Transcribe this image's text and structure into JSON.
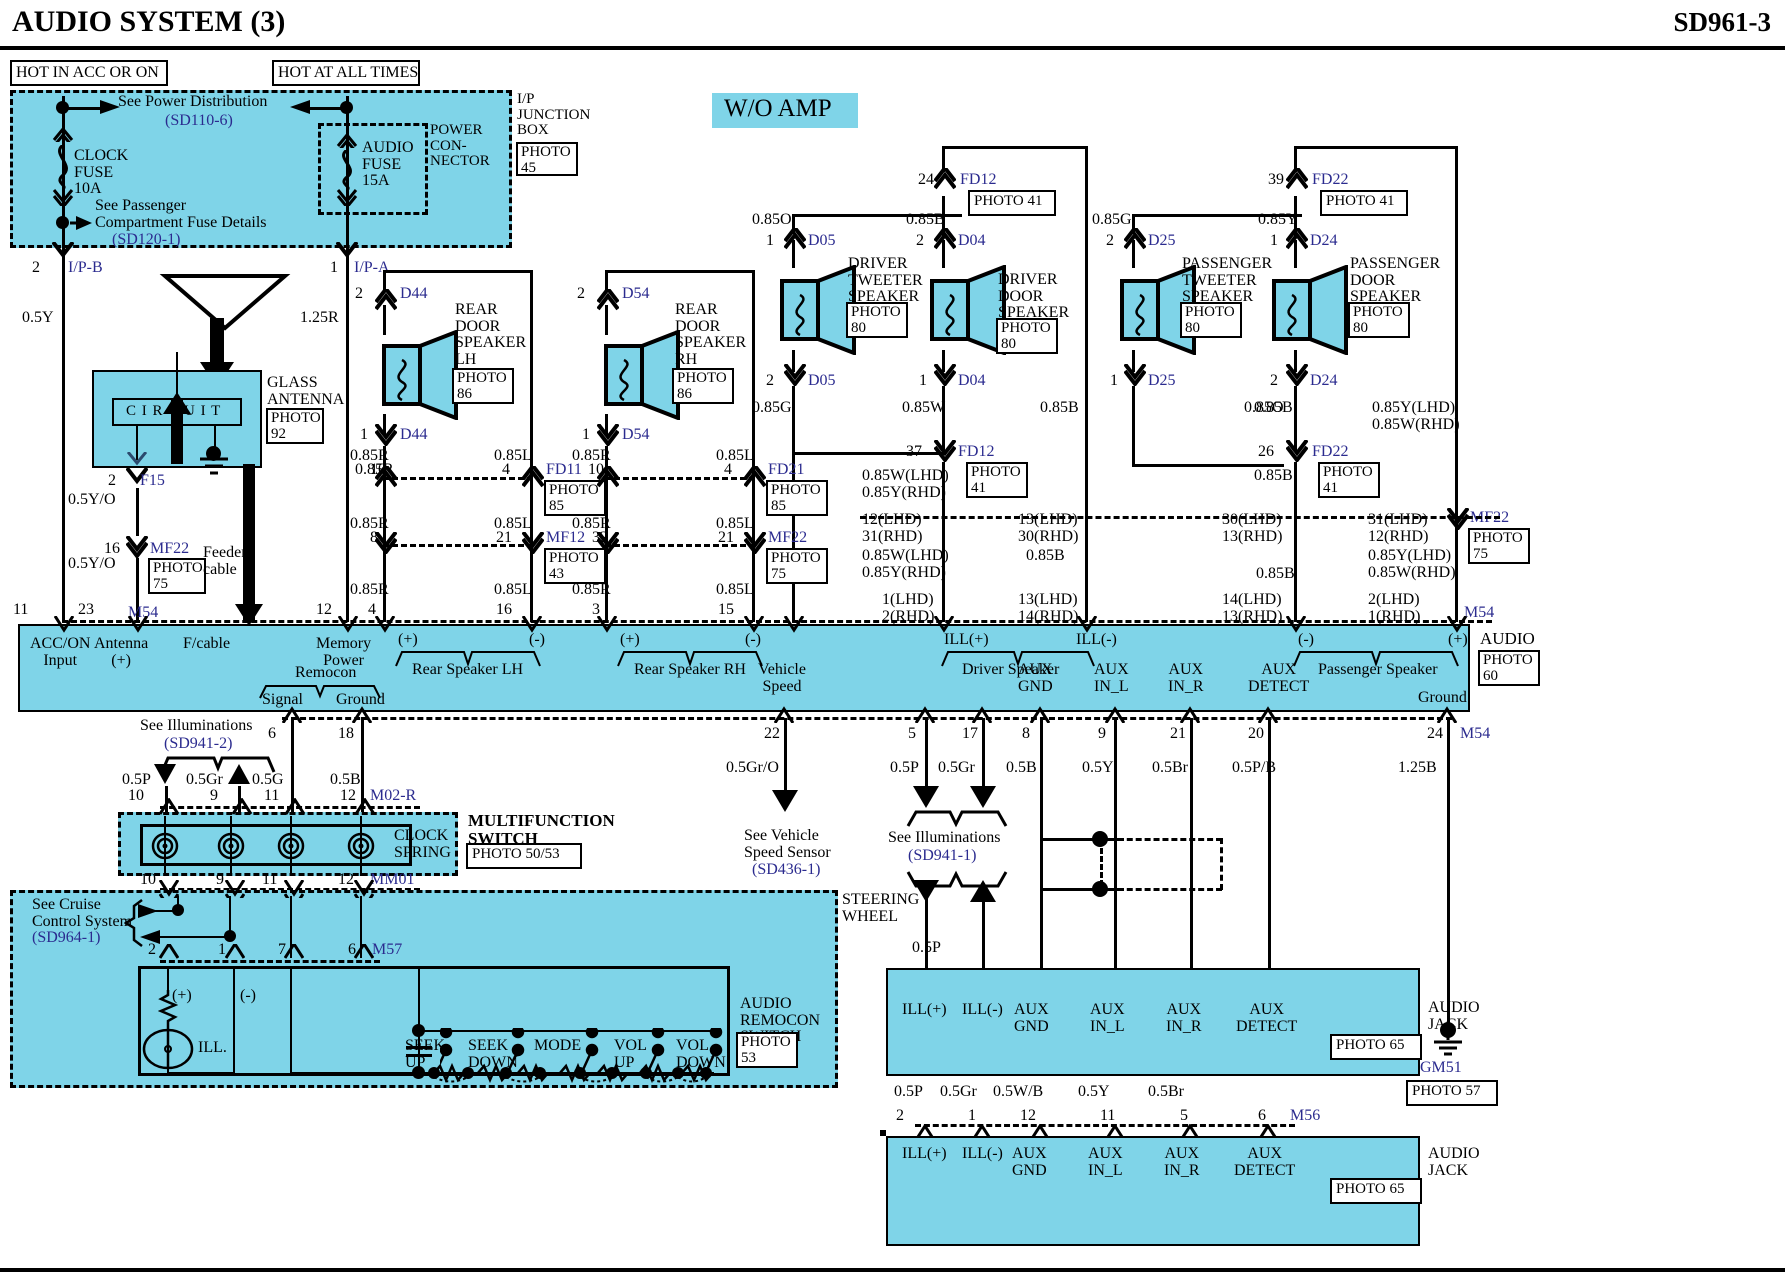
{
  "header": {
    "title": "AUDIO SYSTEM (3)",
    "code": "SD961-3"
  },
  "banner": {
    "wo_amp": "W/O AMP"
  },
  "power": {
    "hot_acc": "HOT IN ACC OR ON",
    "hot_all": "HOT AT ALL TIMES",
    "see_power_dist": "See Power Distribution",
    "see_power_dist_ref": "(SD110-6)",
    "see_passenger_1": "See Passenger",
    "see_passenger_2": "Compartment Fuse Details",
    "see_passenger_ref": "(SD120-1)",
    "clock_fuse": "CLOCK\nFUSE\n10A",
    "audio_fuse": "AUDIO\nFUSE\n15A",
    "power_connector": "POWER\nCON-\nNECTOR",
    "ip_junction_box": "I/P\nJUNCTION\nBOX",
    "photo45": "PHOTO\n45",
    "ipb_pin": "2",
    "ipb_name": "I/P-B",
    "ipa_pin": "1",
    "ipa_name": "I/P-A",
    "wire_05y": "0.5Y",
    "wire_125r": "1.25R"
  },
  "antenna": {
    "label": "GLASS\nANTENNA",
    "photo": "PHOTO\n92",
    "circuit": "C I R C U I T",
    "f15_pin": "2",
    "f15_name": "F15",
    "wire_05yo_top": "0.5Y/O",
    "mf22_pin": "16",
    "mf22_name": "MF22",
    "mf22_photo": "PHOTO\n75",
    "wire_05yo_bot": "0.5Y/O",
    "feeder": "Feeder\ncable"
  },
  "speakers": [
    {
      "name": "REAR\nDOOR\nSPEAKER\nLH",
      "photo": "PHOTO\n86",
      "top_pin": "2",
      "top_conn": "D44",
      "bot_pin": "1",
      "bot_conn": "D44"
    },
    {
      "name": "REAR\nDOOR\nSPEAKER\nRH",
      "photo": "PHOTO\n86",
      "top_pin": "2",
      "top_conn": "D54",
      "bot_pin": "1",
      "bot_conn": "D54"
    },
    {
      "name": "DRIVER\nTWEETER\nSPEAKER",
      "photo": "PHOTO\n80",
      "top_pin": "1",
      "top_conn": "D05",
      "bot_pin": "2",
      "bot_conn": "D05"
    },
    {
      "name": "DRIVER\nDOOR\nSPEAKER",
      "photo": "PHOTO\n80",
      "top_pin": "2",
      "top_conn": "D04",
      "bot_pin": "1",
      "bot_conn": "D04"
    },
    {
      "name": "PASSENGER\nTWEETER\nSPEAKER",
      "photo": "PHOTO\n80",
      "top_pin": "2",
      "top_conn": "D25",
      "bot_pin": "1",
      "bot_conn": "D25"
    },
    {
      "name": "PASSENGER\nDOOR\nSPEAKER",
      "photo": "PHOTO\n80",
      "top_pin": "1",
      "top_conn": "D24",
      "bot_pin": "2",
      "bot_conn": "D24"
    }
  ],
  "connectors": {
    "fd12_top_pin": "24",
    "fd12_top": "FD12",
    "fd12_top_photo": "PHOTO 41",
    "fd22_top_pin": "39",
    "fd22_top": "FD22",
    "fd22_top_photo": "PHOTO 41",
    "fd12_bot_pin": "37",
    "fd12_bot": "FD12",
    "fd12_bot_photo": "PHOTO\n41",
    "fd22_bot_pin": "26",
    "fd22_bot": "FD22",
    "fd22_bot_photo": "PHOTO\n41",
    "fd11_pin": "4",
    "fd11": "FD11",
    "fd11_photo": "PHOTO\n85",
    "fd21_pin": "4",
    "fd21": "FD21",
    "fd21_photo": "PHOTO\n85",
    "mf12_pin_l": "21",
    "mf12": "MF12",
    "mf12_pin_r": "32",
    "mf12_photo": "PHOTO\n43",
    "mf22_rh_pin": "21",
    "mf22_rh": "MF22",
    "mf22_rh_photo": "PHOTO\n75",
    "mf22_right": "MF22",
    "mf22_right_photo": "PHOTO\n75",
    "m54_left": "M54",
    "m54_right": "M54",
    "m02r": "M02-R",
    "mm01": "MM01",
    "m57": "M57",
    "m56": "M56",
    "gm51": "GM51",
    "gm51_photo": "PHOTO 57"
  },
  "wires": {
    "w_085O_a": "0.85O",
    "w_085B_a": "0.85B",
    "w_085G_a": "0.85G",
    "w_085Y_a": "0.85Y",
    "w_085G_b": "0.85G",
    "w_085W_b": "0.85W",
    "w_085B_b": "0.85B",
    "w_085O_b": "0.85O",
    "w_085B_c": "0.85B",
    "w_085R_1": "0.85R",
    "w_085L_1": "0.85L",
    "w_085R_2": "0.85R",
    "w_085L_2": "0.85L",
    "w_085R_3": "0.85R",
    "w_085L_3": "0.85L",
    "w_085R_4": "0.85R",
    "w_085L_4": "0.85L",
    "w_085R_5": "0.85R",
    "w_085L_5": "0.85L",
    "w_085R_6": "0.85R",
    "w_085L_6": "0.85L",
    "w_085WY_1": "0.85W(LHD)\n0.85Y(RHD)",
    "w_085WY_2": "0.85W(LHD)\n0.85Y(RHD)",
    "w_085YW_1": "0.85Y(LHD)\n0.85W(RHD)",
    "w_085YW_2": "0.85Y(LHD)\n0.85W(RHD)",
    "w_085B_d": "0.85B",
    "w_085B_e": "0.85B",
    "w_085B_f": "0.85B",
    "w_085B_g": "0.85B",
    "w_05GrO": "0.5Gr/O",
    "w_05P_1": "0.5P",
    "w_05Gr_1": "0.5Gr",
    "w_05B_1": "0.5B",
    "w_05Y_1": "0.5Y",
    "w_05Br_1": "0.5Br",
    "w_05PB": "0.5P/B",
    "w_125B": "1.25B",
    "w_05P_2": "0.5P",
    "w_05Gr_2": "0.5Gr",
    "w_05G_2": "0.5G",
    "w_05B_2": "0.5B",
    "w_05P_3": "0.5P",
    "w_05Gr_3": "0.5Gr",
    "w_05WB": "0.5W/B",
    "w_05Y_2": "0.5Y",
    "w_05Br_2": "0.5Br"
  },
  "pins_lhd_rhd": {
    "p12_31": "12(LHD)\n31(RHD)",
    "p13_30": "13(LHD)\n30(RHD)",
    "p30_13": "30(LHD)\n13(RHD)",
    "p31_12": "31(LHD)\n12(RHD)",
    "p1_2": "1(LHD)\n2(RHD)",
    "p13_14": "13(LHD)\n14(RHD)",
    "p14_13": "14(LHD)\n13(RHD)",
    "p2_1": "2(LHD)\n1(RHD)"
  },
  "audio_unit": {
    "title": "AUDIO",
    "photo": "PHOTO\n60",
    "terminals": [
      {
        "label": "ACC/ON\nInput",
        "pin": "11"
      },
      {
        "label": "Antenna\n(+)",
        "pin": "23"
      },
      {
        "label": "F/cable",
        "pin": ""
      },
      {
        "label": "Memory\nPower",
        "pin": "12"
      },
      {
        "label": "(+)",
        "pin": "4"
      },
      {
        "label": "(-)",
        "pin": "16"
      },
      {
        "label": "(+)",
        "pin": "3"
      },
      {
        "label": "(-)",
        "pin": "15"
      },
      {
        "label": "Vehicle\nSpeed",
        "pin": "22"
      },
      {
        "label": "ILL(+)",
        "pin": "5"
      },
      {
        "label": "ILL(-)",
        "pin": "17"
      },
      {
        "label": "AUX\nGND",
        "pin": "8"
      },
      {
        "label": "AUX\nIN_L",
        "pin": "9"
      },
      {
        "label": "AUX\nIN_R",
        "pin": "21"
      },
      {
        "label": "AUX\nDETECT",
        "pin": "20"
      },
      {
        "label": "Ground",
        "pin": "24"
      }
    ],
    "group_rear_lh": "Rear Speaker LH",
    "group_rear_rh": "Rear Speaker RH",
    "group_driver": "Driver Speaker",
    "group_passenger": "Passenger Speaker",
    "remocon": "Remocon",
    "remocon_signal": "Signal",
    "remocon_ground": "Ground",
    "remocon_pin_signal": "6",
    "remocon_pin_ground": "18"
  },
  "refs": {
    "illum2": "See Illuminations",
    "illum2_ref": "(SD941-2)",
    "illum1": "See Illuminations",
    "illum1_ref": "(SD941-1)",
    "vss": "See Vehicle\nSpeed Sensor",
    "vss_ref": "(SD436-1)",
    "cruise": "See Cruise\nControl System",
    "cruise_ref": "(SD964-1)"
  },
  "clock_spring": {
    "label": "CLOCK\nSPRING",
    "mf_title": "MULTIFUNCTION\nSWITCH",
    "mf_photo": "PHOTO 50/53",
    "top_pins": [
      "10",
      "9",
      "11",
      "12"
    ],
    "bot_pins": [
      "10",
      "9",
      "11",
      "12"
    ]
  },
  "remocon_switch": {
    "title": "AUDIO\nREMOCON\nSWITCH",
    "photo": "PHOTO\n53",
    "steering_wheel": "STEERING\nWHEEL",
    "pins": [
      "2",
      "1",
      "7",
      "6"
    ],
    "plus": "(+)",
    "minus": "(-)",
    "ill": "ILL.",
    "buttons": [
      "SEEK\nUP",
      "SEEK\nDOWN",
      "MODE",
      "VOL\nUP",
      "VOL\nDOWN"
    ]
  },
  "aux_jack": {
    "title": "AUDIO\nJACK",
    "photo": "PHOTO 65",
    "terminals": [
      "ILL(+)",
      "ILL(-)",
      "AUX\nGND",
      "AUX\nIN_L",
      "AUX\nIN_R",
      "AUX\nDETECT"
    ],
    "pins": [
      "2",
      "1",
      "12",
      "11",
      "5",
      "6"
    ]
  }
}
